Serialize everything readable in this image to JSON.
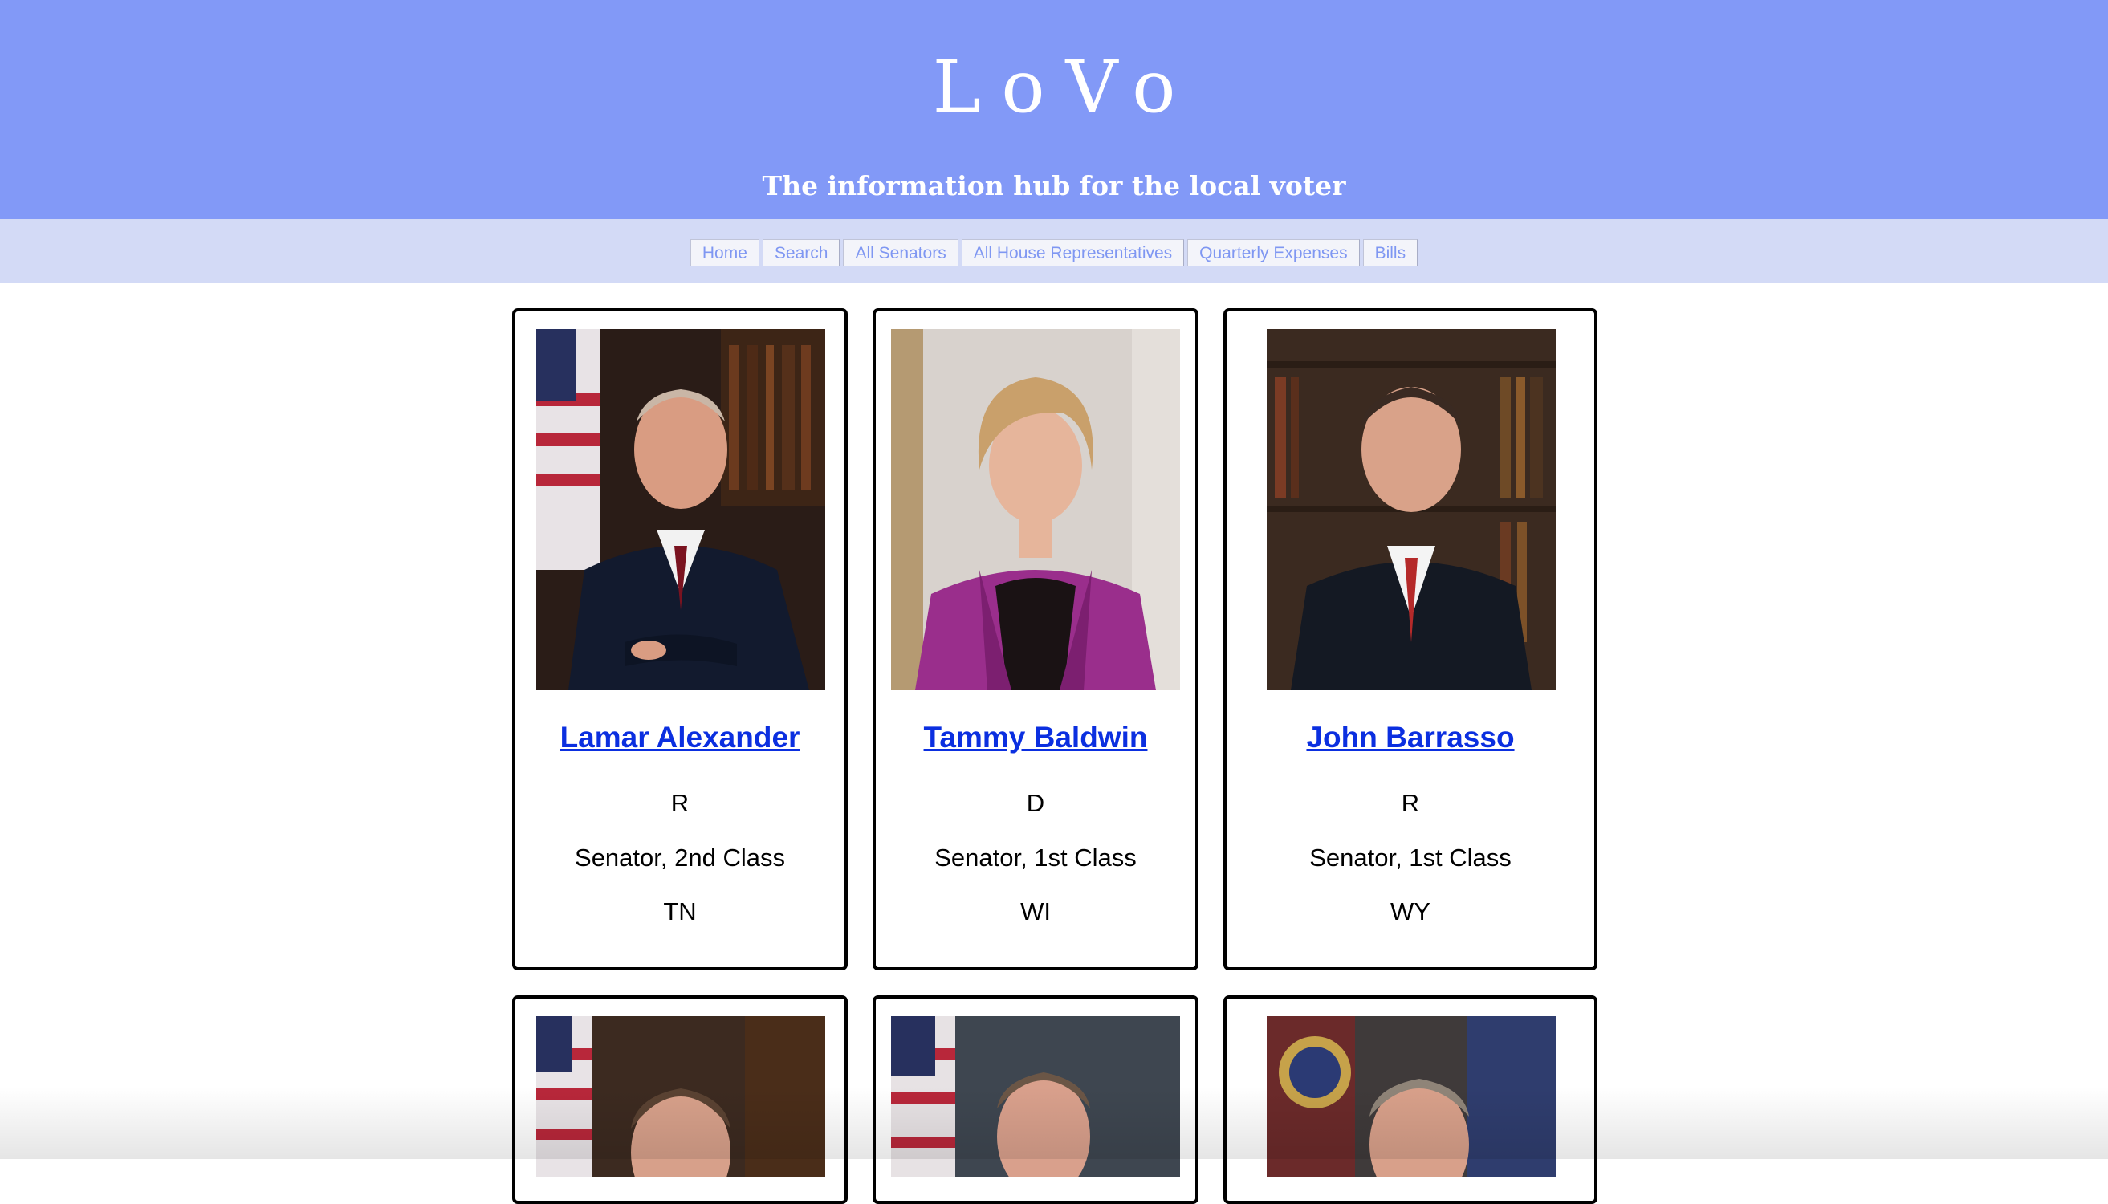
{
  "site": {
    "title": "LoVo",
    "tagline": "The information hub for the local voter"
  },
  "nav": [
    {
      "label": "Home"
    },
    {
      "label": "Search"
    },
    {
      "label": "All Senators"
    },
    {
      "label": "All House Representatives"
    },
    {
      "label": "Quarterly Expenses"
    },
    {
      "label": "Bills"
    }
  ],
  "senators": [
    {
      "name": "Lamar Alexander",
      "party": "R",
      "role": "Senator, 2nd Class",
      "state": "TN"
    },
    {
      "name": "Tammy Baldwin",
      "party": "D",
      "role": "Senator, 1st Class",
      "state": "WI"
    },
    {
      "name": "John Barrasso",
      "party": "R",
      "role": "Senator, 1st Class",
      "state": "WY"
    }
  ],
  "colors": {
    "header": "#8299f7",
    "navbar": "#d3daf6",
    "link": "#0b2fe0",
    "nav_text": "#7f97f2"
  }
}
